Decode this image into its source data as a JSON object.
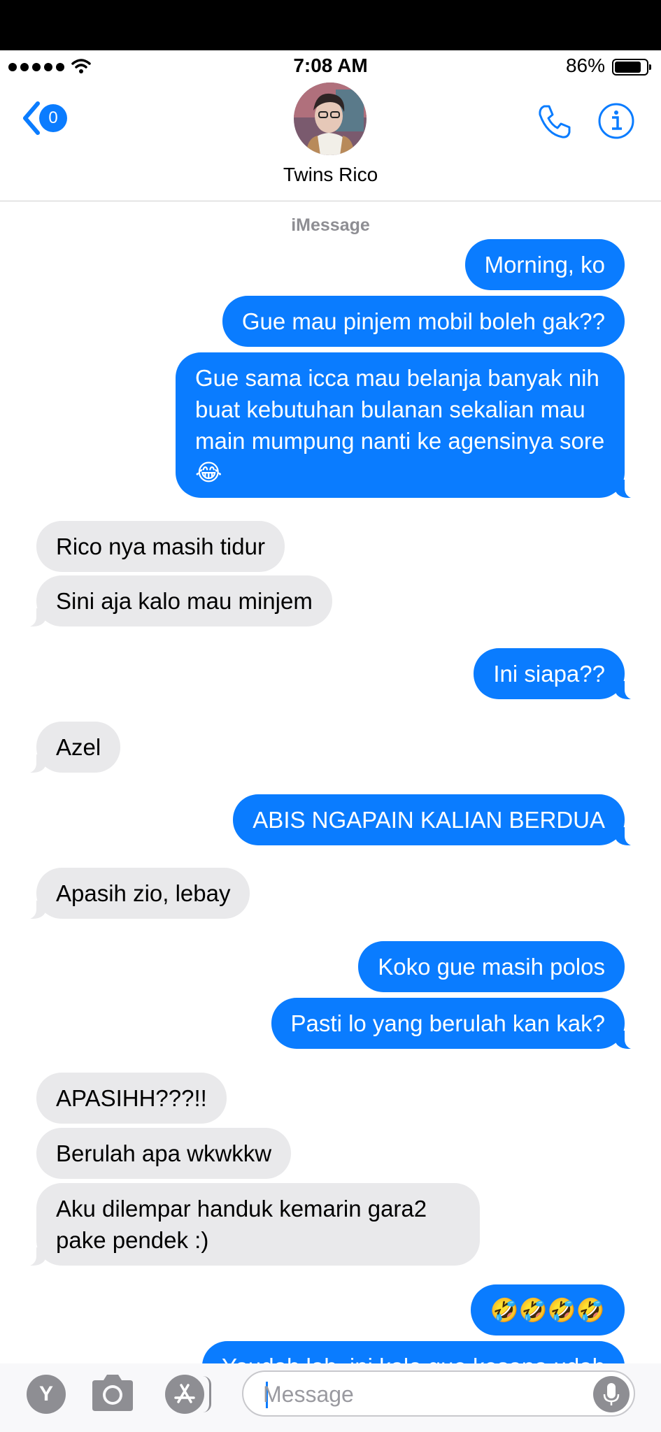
{
  "status_bar": {
    "time": "7:08 AM",
    "battery_percent": "86%",
    "battery_level": 0.86
  },
  "header": {
    "back_badge_count": "0",
    "contact_name": "Twins Rico"
  },
  "thread": {
    "service_label": "iMessage",
    "messages": [
      {
        "from": "me",
        "text": "Morning, ko"
      },
      {
        "from": "me",
        "text": "Gue mau pinjem mobil boleh gak??"
      },
      {
        "from": "me",
        "text": "Gue sama icca mau belanja banyak nih buat kebutuhan bulanan sekalian mau main mumpung nanti ke agensinya sore😂"
      },
      {
        "from": "them",
        "text": "Rico nya masih tidur"
      },
      {
        "from": "them",
        "text": "Sini aja kalo mau minjem"
      },
      {
        "from": "me",
        "text": "Ini siapa??"
      },
      {
        "from": "them",
        "text": "Azel"
      },
      {
        "from": "me",
        "text": "ABIS NGAPAIN KALIAN BERDUA"
      },
      {
        "from": "them",
        "text": "Apasih zio, lebay"
      },
      {
        "from": "me",
        "text": "Koko gue masih polos"
      },
      {
        "from": "me",
        "text": "Pasti lo yang berulah kan kak?"
      },
      {
        "from": "them",
        "text": "APASIHH???!!"
      },
      {
        "from": "them",
        "text": "Berulah apa wkwkkw"
      },
      {
        "from": "them",
        "text": "Aku dilempar handuk kemarin gara2 pake pendek :)"
      },
      {
        "from": "me",
        "text": "🤣🤣🤣🤣"
      },
      {
        "from": "me",
        "text": "Yaudah lah, ini kalo gue kesana udah"
      }
    ]
  },
  "input_bar": {
    "app_button_label": "Y",
    "message_placeholder": "Message"
  },
  "colors": {
    "sent_bubble": "#0a7cff",
    "received_bubble": "#e9e9eb",
    "accent": "#0a7cff"
  },
  "icons": [
    "back-chevron-icon",
    "phone-icon",
    "info-icon",
    "camera-icon",
    "app-store-icon",
    "microphone-icon",
    "wifi-icon",
    "battery-icon"
  ]
}
